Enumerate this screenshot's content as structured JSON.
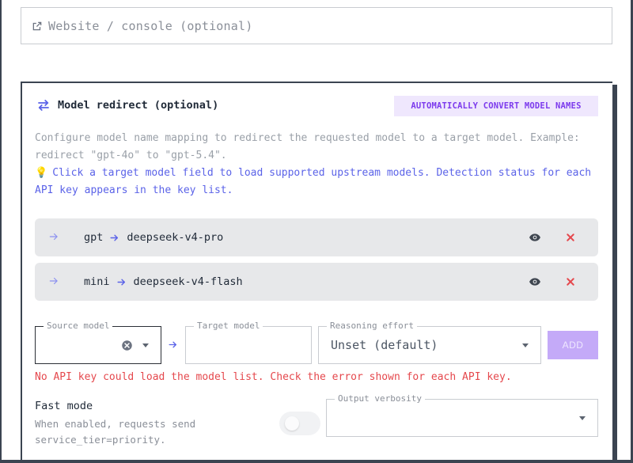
{
  "website_field": {
    "placeholder": "Website / console (optional)",
    "icon": "external-link-icon"
  },
  "redirect": {
    "title": "Model redirect (optional)",
    "badge": "AUTOMATICALLY CONVERT MODEL NAMES",
    "description": "Configure model name mapping to redirect the requested model to a target model. Example: redirect \"gpt-4o\" to \"gpt-5.4\".",
    "hint": "Click a target model field to load supported upstream models. Detection status for each API key appears in the key list.",
    "mappings": [
      {
        "source": "gpt",
        "target": "deepseek-v4-pro"
      },
      {
        "source": "mini",
        "target": "deepseek-v4-flash"
      }
    ]
  },
  "form": {
    "source_label": "Source model",
    "source_value": "",
    "target_label": "Target model",
    "target_value": "",
    "reasoning_label": "Reasoning effort",
    "reasoning_value": "Unset (default)",
    "add_label": "ADD",
    "error": "No API key could load the model list. Check the error shown for each API key."
  },
  "fast_mode": {
    "title": "Fast mode",
    "description": "When enabled, requests send service_tier=priority.",
    "enabled": false
  },
  "output_verbosity": {
    "label": "Output verbosity",
    "value": ""
  },
  "colors": {
    "accent": "#7c3aed",
    "link": "#5b63e8",
    "error": "#e5484d",
    "delete": "#e5484d"
  }
}
